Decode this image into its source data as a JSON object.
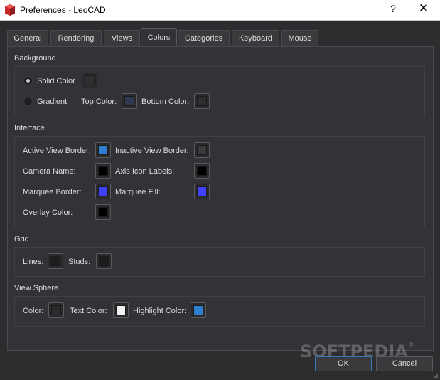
{
  "window": {
    "title": "Preferences - LeoCAD",
    "help_symbol": "?",
    "close_symbol": "✕"
  },
  "tabs": [
    {
      "label": "General"
    },
    {
      "label": "Rendering"
    },
    {
      "label": "Views"
    },
    {
      "label": "Colors"
    },
    {
      "label": "Categories"
    },
    {
      "label": "Keyboard"
    },
    {
      "label": "Mouse"
    }
  ],
  "active_tab": "Colors",
  "background": {
    "title": "Background",
    "solid_label": "Solid Color",
    "gradient_label": "Gradient",
    "top_color_label": "Top Color:",
    "bottom_color_label": "Bottom Color:",
    "selected": "solid",
    "colors": {
      "solid": "#2f2f32",
      "top": "#2e3a52",
      "bottom": "#2f2f32"
    }
  },
  "interface": {
    "title": "Interface",
    "active_view_border_label": "Active View Border:",
    "inactive_view_border_label": "Inactive View Border:",
    "camera_name_label": "Camera Name:",
    "axis_icon_labels_label": "Axis Icon Labels:",
    "marquee_border_label": "Marquee Border:",
    "marquee_fill_label": "Marquee Fill:",
    "overlay_color_label": "Overlay Color:",
    "colors": {
      "active_view_border": "#2e7fd0",
      "inactive_view_border": "#3a3a3d",
      "camera_name": "#000000",
      "axis_icon_labels": "#000000",
      "marquee_border": "#4040ff",
      "marquee_fill": "#4040ff",
      "overlay_color": "#000000"
    }
  },
  "grid": {
    "title": "Grid",
    "lines_label": "Lines:",
    "studs_label": "Studs:",
    "colors": {
      "lines": "#1e1e20",
      "studs": "#1e1e20"
    }
  },
  "view_sphere": {
    "title": "View Sphere",
    "color_label": "Color:",
    "text_color_label": "Text Color:",
    "highlight_color_label": "Highlight Color:",
    "colors": {
      "color": "#2b2b2e",
      "text": "#f0f0f0",
      "highlight": "#2e7fd0"
    }
  },
  "buttons": {
    "ok": "OK",
    "cancel": "Cancel"
  },
  "watermark": {
    "text": "SOFTPEDIA",
    "mark": "®"
  }
}
